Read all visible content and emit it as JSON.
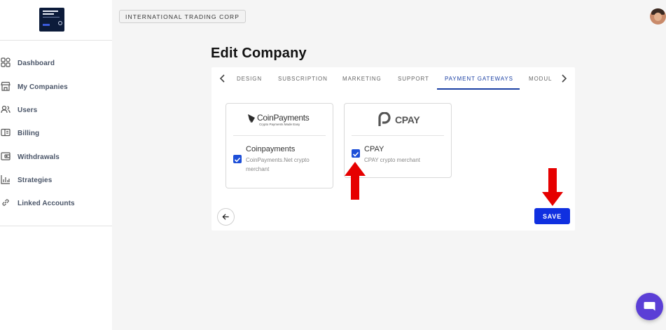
{
  "sidebar": {
    "items": [
      {
        "label": "Dashboard",
        "icon": "dashboard-icon"
      },
      {
        "label": "My Companies",
        "icon": "store-icon"
      },
      {
        "label": "Users",
        "icon": "users-icon"
      },
      {
        "label": "Billing",
        "icon": "billing-icon"
      },
      {
        "label": "Withdrawals",
        "icon": "wallet-icon"
      },
      {
        "label": "Strategies",
        "icon": "bar-chart-icon"
      },
      {
        "label": "Linked Accounts",
        "icon": "link-icon"
      }
    ]
  },
  "header": {
    "company": "INTERNATIONAL TRADING CORP"
  },
  "page": {
    "title": "Edit Company"
  },
  "tabs": {
    "items": [
      "DESIGN",
      "SUBSCRIPTION",
      "MARKETING",
      "SUPPORT",
      "PAYMENT GATEWAYS",
      "MODUL"
    ],
    "active": "PAYMENT GATEWAYS"
  },
  "gateways": [
    {
      "logo_text": "CoinPayments",
      "logo_tagline": "Crypto Payments Made Easy",
      "name": "Coinpayments",
      "description_line1": "CoinPayments.Net crypto",
      "description_line2": "merchant",
      "checked": true
    },
    {
      "logo_text": "CPAY",
      "name": "CPAY",
      "description_line1": "CPAY crypto merchant",
      "checked": true
    }
  ],
  "actions": {
    "save_label": "SAVE"
  },
  "colors": {
    "primary": "#1030e0",
    "accent_tab": "#1a3fa3",
    "checkbox": "#1d4fd8",
    "annotation_arrow": "#e60000",
    "chat": "#5b3fd6"
  }
}
